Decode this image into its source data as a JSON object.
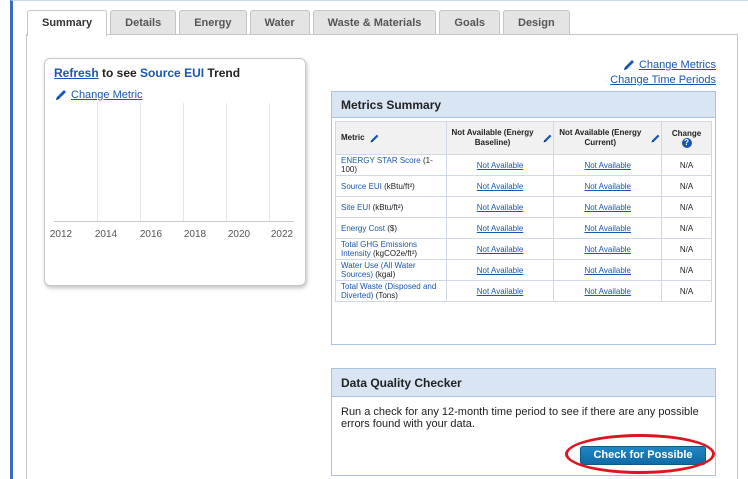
{
  "tabs": [
    {
      "label": "Summary"
    },
    {
      "label": "Details"
    },
    {
      "label": "Energy"
    },
    {
      "label": "Water"
    },
    {
      "label": "Waste & Materials"
    },
    {
      "label": "Goals"
    },
    {
      "label": "Design"
    }
  ],
  "active_tab": "Summary",
  "trend": {
    "refresh": "Refresh",
    "to_see": " to see ",
    "metric_name": "Source EUI",
    "trend_word": " Trend",
    "change_metric": "Change Metric",
    "x_ticks": [
      "2012",
      "2014",
      "2016",
      "2018",
      "2020",
      "2022"
    ]
  },
  "right_links": {
    "change_metrics": "Change Metrics",
    "change_time_periods": "Change Time Periods"
  },
  "metrics_summary": {
    "title": "Metrics Summary",
    "columns": {
      "metric": "Metric",
      "baseline": "Not Available (Energy Baseline)",
      "current": "Not Available (Energy Current)",
      "change": "Change"
    },
    "rows": [
      {
        "name": "ENERGY STAR Score",
        "unit": " (1-100)",
        "baseline": "Not Available",
        "current": "Not Available",
        "change": "N/A"
      },
      {
        "name": "Source EUI",
        "unit": " (kBtu/ft²)",
        "baseline": "Not Available",
        "current": "Not Available",
        "change": "N/A"
      },
      {
        "name": "Site EUI",
        "unit": " (kBtu/ft²)",
        "baseline": "Not Available",
        "current": "Not Available",
        "change": "N/A"
      },
      {
        "name": "Energy Cost",
        "unit": " ($)",
        "baseline": "Not Available",
        "current": "Not Available",
        "change": "N/A"
      },
      {
        "name": "Total GHG Emissions Intensity",
        "unit": " (kgCO2e/ft²)",
        "baseline": "Not Available",
        "current": "Not Available",
        "change": "N/A"
      },
      {
        "name": "Water Use (All Water Sources)",
        "unit": " (kgal)",
        "baseline": "Not Available",
        "current": "Not Available",
        "change": "N/A"
      },
      {
        "name": "Total Waste (Disposed and Diverted)",
        "unit": " (Tons)",
        "baseline": "Not Available",
        "current": "Not Available",
        "change": "N/A"
      }
    ]
  },
  "data_quality": {
    "title": "Data Quality Checker",
    "description": "Run a check for any 12-month time period to see if there are any possible errors found with your data.",
    "button": "Check for Possible Errors"
  },
  "colors": {
    "link": "#1a56b3",
    "panel_header": "#d9e5f3",
    "button": "#0f6aa6",
    "callout": "#e0141e"
  }
}
